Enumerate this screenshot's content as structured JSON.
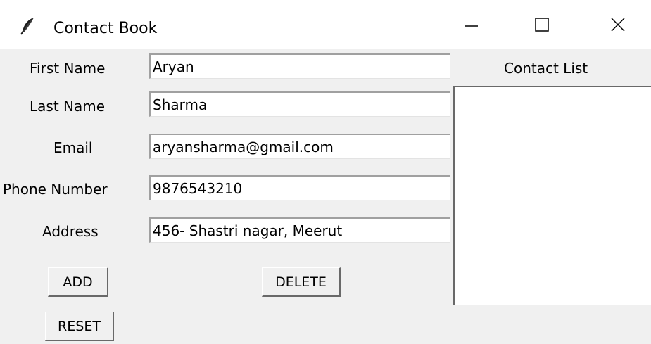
{
  "window": {
    "title": "Contact Book",
    "icon": "feather-icon",
    "controls": [
      "minimize-icon",
      "maximize-icon",
      "close-icon"
    ]
  },
  "form": {
    "first_name": {
      "label": "First Name",
      "value": "Aryan"
    },
    "last_name": {
      "label": "Last Name",
      "value": "Sharma"
    },
    "email": {
      "label": "Email",
      "value": "aryansharma@gmail.com"
    },
    "phone": {
      "label": "Phone Number",
      "value": "9876543210"
    },
    "address": {
      "label": "Address",
      "value": "456- Shastri nagar, Meerut"
    }
  },
  "buttons": {
    "add": "ADD",
    "delete": "DELETE",
    "reset": "RESET"
  },
  "contact_list": {
    "title": "Contact List",
    "items": []
  }
}
